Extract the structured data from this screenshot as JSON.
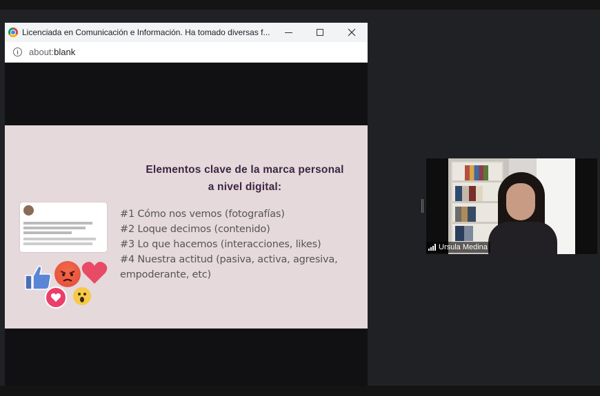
{
  "browser": {
    "title": "Licenciada en Comunicación e Información. Ha tomado diversas f...",
    "url_prefix": "about:",
    "url_main": "blank"
  },
  "slide": {
    "title_line1": "Elementos clave de la marca personal",
    "title_line2": "a nivel digital:",
    "items": [
      "#1 Cómo nos vemos (fotografías)",
      "#2 Loque decimos (contenido)",
      "#3 Lo que hacemos (interacciones, likes)",
      "#4 Nuestra actitud (pasiva, activa, agresiva, empoderante, etc)"
    ]
  },
  "video": {
    "participant_name": "Ursula Medina"
  },
  "colors": {
    "slide_bg": "#e6d9dc",
    "title_color": "#3d2644",
    "heart": "#ea3f6a",
    "angry": "#e24b3a"
  }
}
